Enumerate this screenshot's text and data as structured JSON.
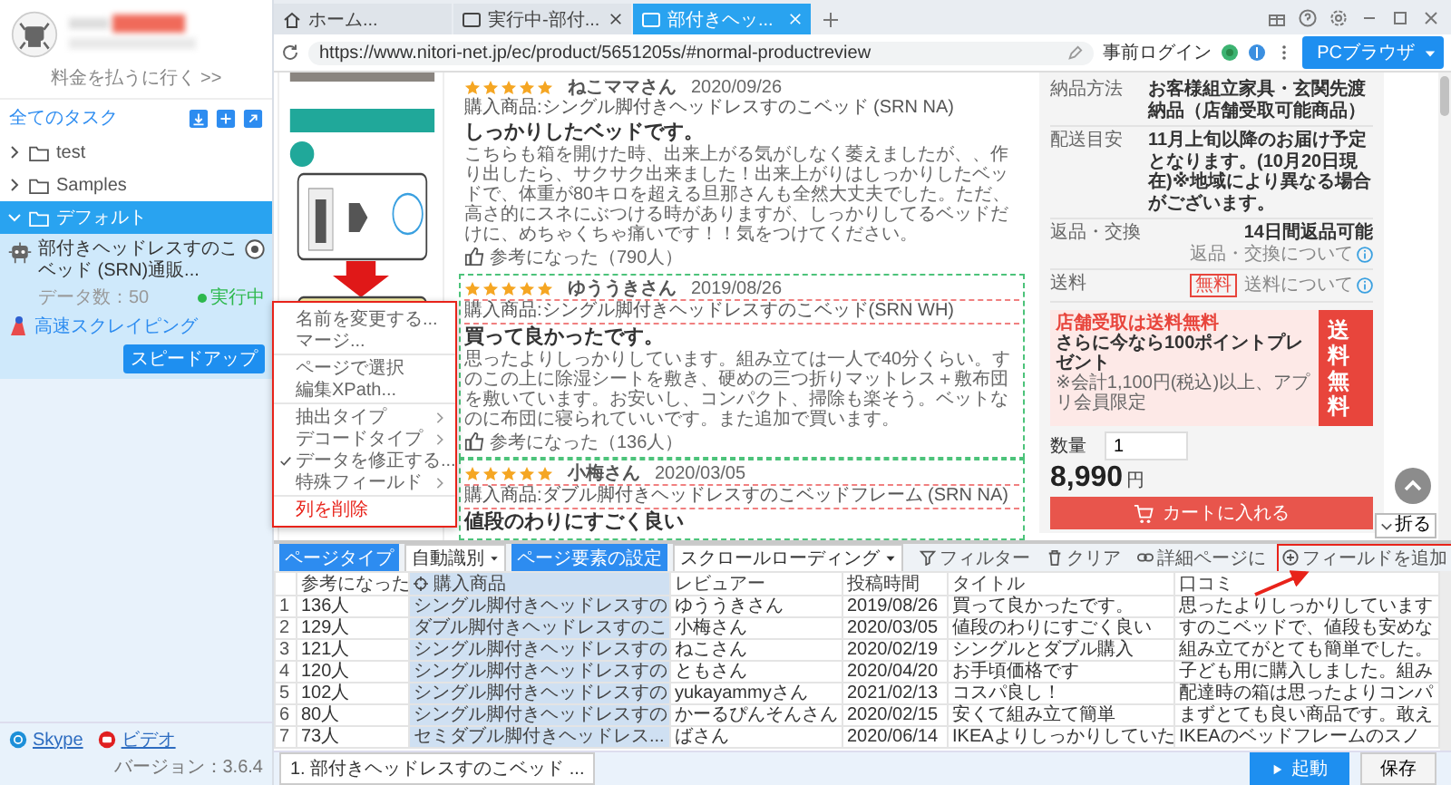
{
  "sidebar": {
    "billing_link": "料金を払うに行く >>",
    "section_title": "全てのタスク",
    "folders": [
      {
        "label": "test",
        "expanded": false,
        "selected": false
      },
      {
        "label": "Samples",
        "expanded": false,
        "selected": false
      },
      {
        "label": "デフォルト",
        "expanded": true,
        "selected": true,
        "children": [
          {
            "title": "部付きヘッドレスすのこベッド (SRN)通販...",
            "data_count": "データ数：50",
            "status": "実行中",
            "mode": "高速スクレイピング",
            "action": "スピードアップ"
          }
        ]
      }
    ],
    "footer": {
      "links": [
        {
          "kind": "skype",
          "label": "Skype"
        },
        {
          "kind": "video",
          "label": "ビデオ"
        }
      ],
      "version": "バージョン：3.6.4"
    }
  },
  "tabs": [
    {
      "kind": "home",
      "label": "ホーム...",
      "closable": false,
      "selected": false
    },
    {
      "kind": "page",
      "label": "実行中-部付...",
      "closable": true,
      "selected": false
    },
    {
      "kind": "page",
      "label": "部付きヘッ...",
      "closable": true,
      "selected": true
    }
  ],
  "address_bar": {
    "url": "https://www.nitori-net.jp/ec/product/5651205s/#normal-productreview",
    "login": "事前ログイン",
    "mode": "PCブラウザ"
  },
  "page": {
    "reviews": [
      {
        "stars": 5,
        "name": "ねこママさん",
        "date": "2020/09/26",
        "product": "購入商品:シングル脚付きヘッドレスすのこベッド (SRN NA)",
        "title": "しっかりしたベッドです。",
        "body": "こちらも箱を開けた時、出来上がる気がしなく萎えましたが、、作り出したら、サクサク出来ました！出来上がりはしっかりしたベッドで、体重が80キロを超える旦那さんも全然大丈夫でした。ただ、高さ的にスネにぶつける時がありますが、しっかりしてるベッドだけに、めちゃくちゃ痛いです！！気をつけてください。",
        "helpful": "参考になった（790人）",
        "highlighted": false
      },
      {
        "stars": 5,
        "name": "ゆううきさん",
        "date": "2019/08/26",
        "product": "購入商品:シングル脚付きヘッドレスすのこベッド(SRN WH)",
        "title": "買って良かったです。",
        "body": "思ったよりしっかりしています。組み立ては一人で40分くらい。すのこの上に除湿シートを敷き、硬めの三つ折りマットレス＋敷布団を敷いています。お安いし、コンパクト、掃除も楽そう。ベットなのに布団に寝られていいです。また追加で買います。",
        "helpful": "参考になった（136人）",
        "highlighted": true
      },
      {
        "stars": 5,
        "name": "小梅さん",
        "date": "2020/03/05",
        "product": "購入商品:ダブル脚付きヘッドレスすのこベッドフレーム (SRN NA)",
        "title": "値段のわりにすごく良い",
        "highlighted": true
      }
    ],
    "details": [
      {
        "label": "納品方法",
        "value": "お客様組立家具・玄関先渡納品（店舗受取可能商品）"
      },
      {
        "label": "配送目安",
        "value": "11月上旬以降のお届け予定となります。(10月20日現在)※地域により異なる場合がございます。"
      },
      {
        "label": "返品・交換",
        "value": "14日間返品可能",
        "link": "返品・交換について"
      },
      {
        "label": "送料",
        "badge": "無料",
        "link": "送料について"
      }
    ],
    "banner": {
      "headline": "店舗受取は送料無料",
      "offer": "さらに今なら100ポイントプレゼント",
      "note": "※会計1,100円(税込)以上、アプリ会員限定",
      "tag": "送料無料"
    },
    "quantity_label": "数量",
    "quantity": "1",
    "price": "8,990",
    "currency": "円",
    "cart_button": "カートに入れる",
    "fold_button": "折る"
  },
  "context_menu": {
    "highlighted": true,
    "groups": [
      [
        {
          "label": "名前を変更する...",
          "kind": "action",
          "checked": false
        },
        {
          "label": "マージ...",
          "kind": "action",
          "checked": false
        }
      ],
      [
        {
          "label": "ページで選択",
          "kind": "action",
          "checked": false
        },
        {
          "label": "編集XPath...",
          "kind": "action",
          "checked": false
        }
      ],
      [
        {
          "label": "抽出タイプ",
          "kind": "submenu",
          "checked": false
        },
        {
          "label": "デコードタイプ",
          "kind": "submenu",
          "checked": false
        },
        {
          "label": "データを修正する...",
          "kind": "action",
          "checked": true
        },
        {
          "label": "特殊フィールド",
          "kind": "submenu",
          "checked": false
        }
      ],
      [
        {
          "label": "列を削除",
          "kind": "delete",
          "checked": false
        }
      ]
    ]
  },
  "toolbar": {
    "page_type_label": "ページタイプ",
    "page_type_value": "自動識別",
    "element_button": "ページ要素の設定",
    "loading_value": "スクロールローディング",
    "actions": [
      {
        "kind": "filter",
        "label": "フィルター",
        "highlighted": false
      },
      {
        "kind": "clear",
        "label": "クリア",
        "highlighted": false
      },
      {
        "kind": "link",
        "label": "詳細ページに",
        "highlighted": false
      },
      {
        "kind": "add",
        "label": "フィールドを追加",
        "highlighted": true
      }
    ]
  },
  "table": {
    "columns": [
      {
        "label": "参考になった",
        "selected": false
      },
      {
        "label": "購入商品",
        "selected": true
      },
      {
        "label": "レビュアー",
        "selected": false
      },
      {
        "label": "投稿時間",
        "selected": false
      },
      {
        "label": "タイトル",
        "selected": false
      },
      {
        "label": "口コミ",
        "selected": false
      }
    ],
    "rows": [
      {
        "no": "1",
        "cells": [
          "136人",
          "シングル脚付きヘッドレスすの",
          "ゆううきさん",
          "2019/08/26",
          "買って良かったです。",
          "思ったよりしっかりしています"
        ]
      },
      {
        "no": "2",
        "cells": [
          "129人",
          "ダブル脚付きヘッドレスすのこ",
          "小梅さん",
          "2020/03/05",
          "値段のわりにすごく良い",
          "すのこベッドで、値段も安めな"
        ]
      },
      {
        "no": "3",
        "cells": [
          "121人",
          "シングル脚付きヘッドレスすの",
          "ねこさん",
          "2020/02/19",
          "シングルとダブル購入",
          "組み立てがとても簡単でした。"
        ]
      },
      {
        "no": "4",
        "cells": [
          "120人",
          "シングル脚付きヘッドレスすの",
          "ともさん",
          "2020/04/20",
          "お手頃価格です",
          "子ども用に購入しました。組み"
        ]
      },
      {
        "no": "5",
        "cells": [
          "102人",
          "シングル脚付きヘッドレスすの",
          "yukayammyさん",
          "2021/02/13",
          "コスパ良し！",
          "配達時の箱は思ったよりコンパ"
        ]
      },
      {
        "no": "6",
        "cells": [
          "80人",
          "シングル脚付きヘッドレスすの",
          "かーるぴんそんさん",
          "2020/02/15",
          "安くて組み立て簡単",
          "まずとても良い商品です。敢え"
        ]
      },
      {
        "no": "7",
        "cells": [
          "73人",
          "セミダブル脚付きヘッドレス...",
          "ばさん",
          "2020/06/14",
          "IKEAよりしっかりしていた",
          "IKEAのベッドフレームのスノ"
        ]
      }
    ]
  },
  "footer_bar": {
    "task_tab": "1. 部付きヘッドレスすのこベッド ...",
    "start_button": "起動",
    "save_button": "保存"
  }
}
